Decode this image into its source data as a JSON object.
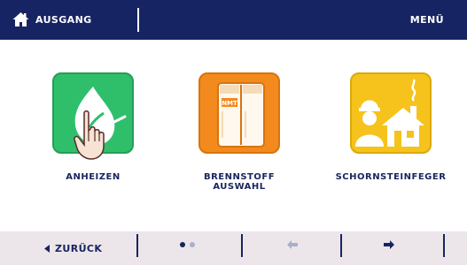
{
  "header": {
    "home_label": "AUSGANG",
    "menu_label": "MENÜ",
    "home_icon": "home-icon"
  },
  "tiles": [
    {
      "label": "ANHEIZEN",
      "icon": "flame-hand-icon",
      "color": "#2fbf6b"
    },
    {
      "label": "BRENNSTOFF\nAUSWAHL",
      "icon": "fuel-bag-icon",
      "color": "#f28a1d",
      "icon_text": "NMT"
    },
    {
      "label": "SCHORNSTEINFEGER",
      "icon": "chimney-sweep-icon",
      "color": "#f6c21c"
    }
  ],
  "footer": {
    "back_label": "ZURÜCK",
    "page_indicator": {
      "current": 1,
      "total": 2
    },
    "prev_icon": "arrow-left-icon",
    "next_icon": "arrow-right-icon"
  },
  "colors": {
    "header_bg": "#172463",
    "footer_bg": "#ece6ea",
    "text_dark": "#1a2660",
    "disabled": "#a9b0c8"
  }
}
